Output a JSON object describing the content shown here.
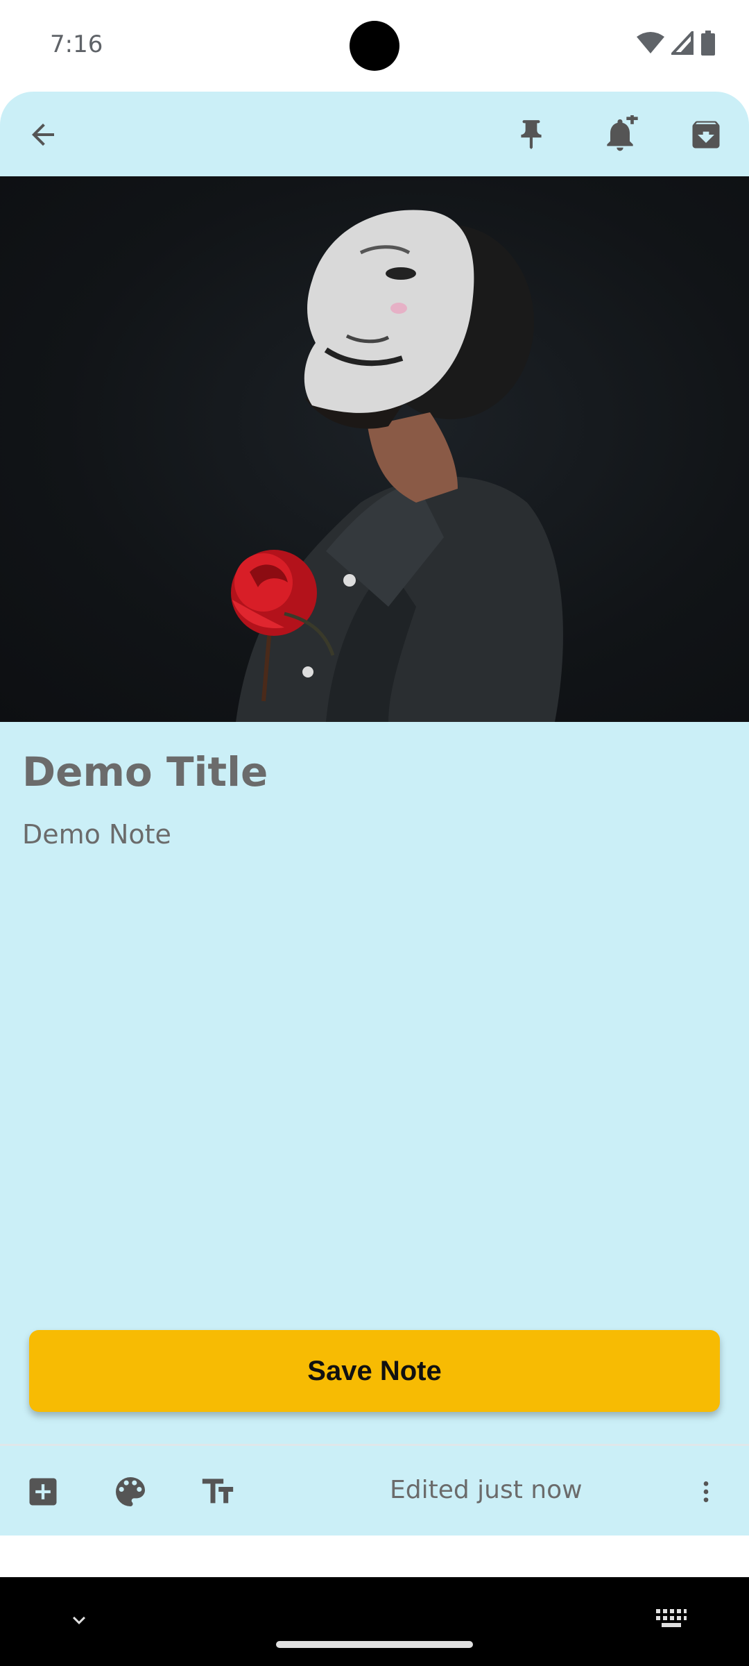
{
  "status_bar": {
    "time": "7:16"
  },
  "toolbar": {
    "back_icon": "arrow-left-icon",
    "pin_icon": "pin-icon",
    "reminder_icon": "bell-plus-icon",
    "archive_icon": "archive-icon"
  },
  "note": {
    "title": "Demo Title",
    "body": "Demo Note",
    "image": "photo of masked man with red rose"
  },
  "save_button": {
    "label": "Save Note"
  },
  "bottom_bar": {
    "add_icon": "add-box-icon",
    "palette_icon": "palette-icon",
    "text_format_icon": "text-format-icon",
    "status": "Edited just now",
    "more_icon": "more-vertical-icon"
  },
  "colors": {
    "note_background": "#cbeff7",
    "accent": "#f7bb03",
    "text": "#6b6b6b"
  }
}
